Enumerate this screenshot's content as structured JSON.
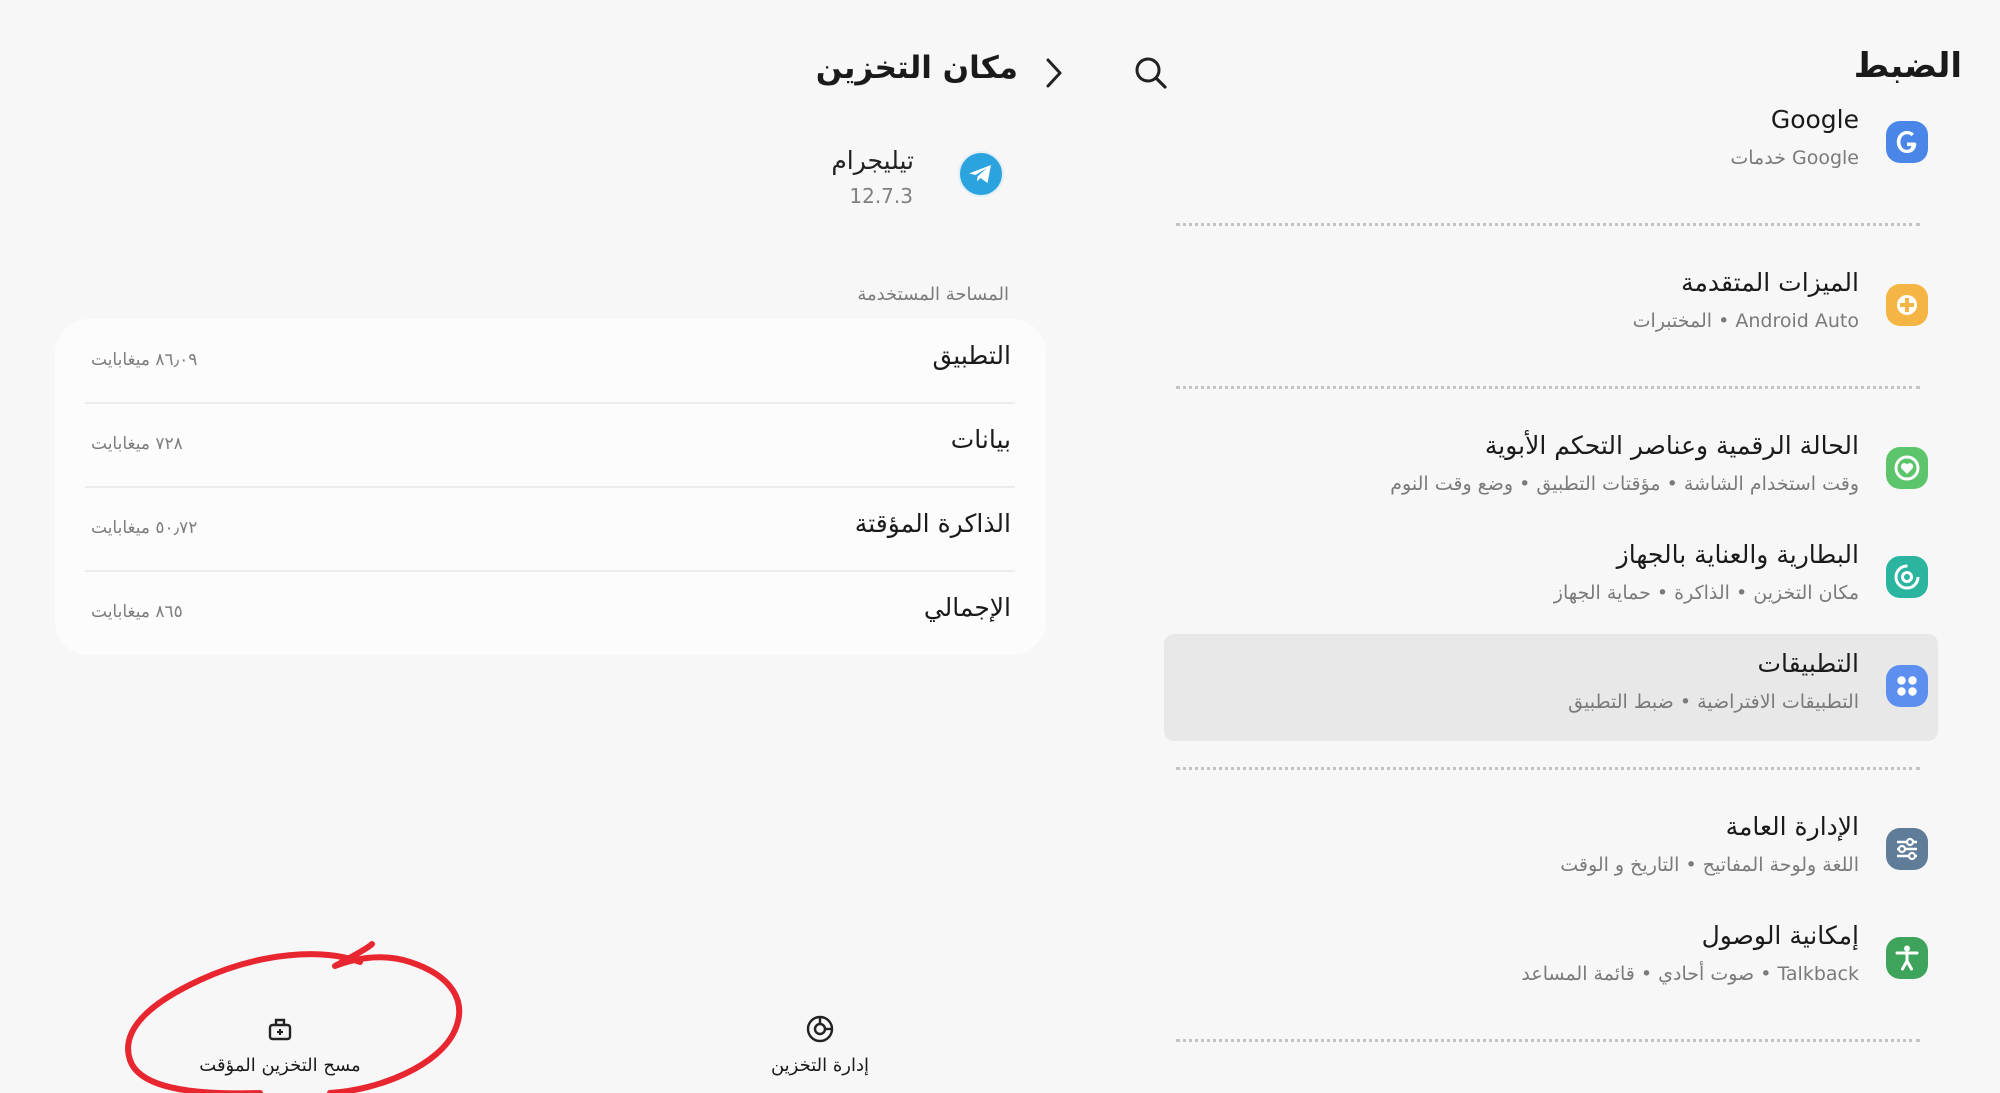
{
  "settings": {
    "title": "الضبط",
    "items": [
      {
        "title": "Google",
        "subtitle": "خدمات Google",
        "icon": "google-icon",
        "color": "#4a86e8"
      },
      {
        "title": "الميزات المتقدمة",
        "subtitle": "المختبرات  •  Android Auto",
        "icon": "advanced-features-icon",
        "color": "#f5b544"
      },
      {
        "title": "الحالة الرقمية وعناصر التحكم الأبوية",
        "subtitle": "وقت استخدام الشاشة  •  مؤقتات التطبيق  •  وضع وقت النوم",
        "icon": "digital-wellbeing-icon",
        "color": "#5cc46a"
      },
      {
        "title": "البطارية والعناية بالجهاز",
        "subtitle": "مكان التخزين  •  الذاكرة  •  حماية الجهاز",
        "icon": "device-care-icon",
        "color": "#2bb5a0"
      },
      {
        "title": "التطبيقات",
        "subtitle": "التطبيقات الافتراضية  •  ضبط التطبيق",
        "icon": "apps-icon",
        "color": "#5d8ff0"
      },
      {
        "title": "الإدارة العامة",
        "subtitle": "اللغة ولوحة المفاتيح  •  التاريخ و الوقت",
        "icon": "general-management-icon",
        "color": "#5f7c98"
      },
      {
        "title": "إمكانية الوصول",
        "subtitle": "صوت أحادي  •  قائمة المساعد  •  Talkback",
        "icon": "accessibility-icon",
        "color": "#3fa45b"
      }
    ]
  },
  "storage": {
    "title": "مكان التخزين",
    "app_name": "تيليجرام",
    "app_version": "12.7.3",
    "used_space_header": "المساحة المستخدمة",
    "rows": [
      {
        "label": "التطبيق",
        "value": "٨٦٫٠٩ ميغابايت"
      },
      {
        "label": "بيانات",
        "value": "٧٢٨ ميغابايت"
      },
      {
        "label": "الذاكرة المؤقتة",
        "value": "٥٠٫٧٢ ميغابايت"
      },
      {
        "label": "الإجمالي",
        "value": "٨٦٥ ميغابايت"
      }
    ],
    "manage_storage_label": "إدارة التخزين",
    "clear_cache_label": "مسح التخزين المؤقت"
  },
  "colors": {
    "background": "#f7f7f7",
    "selected_item": "#e8e8e8",
    "annotation_red": "#e8262f",
    "telegram_blue": "#2aa3df"
  }
}
